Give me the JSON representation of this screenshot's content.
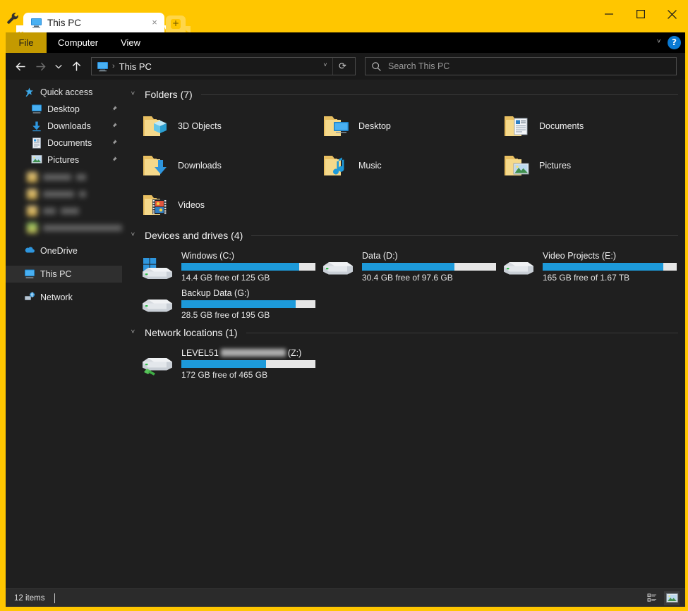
{
  "window": {
    "accent_color": "#ffc600",
    "content_bg": "#1f1f1f",
    "tool_icon": "wrench-icon",
    "tab_title": "This PC",
    "tab_close_glyph": "×",
    "newtab_glyph": "+",
    "minimize_glyph": "─",
    "maximize_glyph": "□",
    "close_glyph": "✕"
  },
  "ribbon": {
    "tabs": [
      {
        "label": "File",
        "selected": true
      },
      {
        "label": "Computer",
        "selected": false
      },
      {
        "label": "View",
        "selected": false
      }
    ],
    "collapse_glyph": "ⱽ",
    "help_glyph": "?"
  },
  "address": {
    "back_glyph": "←",
    "forward_glyph": "→",
    "recent_glyph": "ⱽ",
    "up_glyph": "↑",
    "crumb_icon": "this-pc-icon",
    "crumb_sep": "›",
    "crumb_text": "This PC",
    "dropdown_glyph": "ⱽ",
    "refresh_glyph": "⟳"
  },
  "search": {
    "icon": "search-icon",
    "placeholder": "Search This PC",
    "value": ""
  },
  "sidebar": {
    "items": [
      {
        "label": "Quick access",
        "icon": "star-pin-icon",
        "indent": 0,
        "pinned": false,
        "selected": false
      },
      {
        "label": "Desktop",
        "icon": "desktop-icon",
        "indent": 1,
        "pinned": true,
        "selected": false
      },
      {
        "label": "Downloads",
        "icon": "downloads-icon",
        "indent": 1,
        "pinned": true,
        "selected": false
      },
      {
        "label": "Documents",
        "icon": "documents-icon",
        "indent": 1,
        "pinned": true,
        "selected": false
      },
      {
        "label": "Pictures",
        "icon": "pictures-icon",
        "indent": 1,
        "pinned": true,
        "selected": false
      }
    ],
    "redacted_items": [
      {
        "icon_tint": "yellow",
        "bar1": 62,
        "bar2": 22
      },
      {
        "icon_tint": "yellow",
        "bar1": 74,
        "bar2": 40
      },
      {
        "icon_tint": "yellow",
        "bar1": 30,
        "bar2": 46
      },
      {
        "icon_tint": "green",
        "bar1": 120,
        "bar2": 0
      }
    ],
    "roots": [
      {
        "label": "OneDrive",
        "icon": "onedrive-cloud-icon",
        "selected": false
      },
      {
        "label": "This PC",
        "icon": "this-pc-icon",
        "selected": true
      },
      {
        "label": "Network",
        "icon": "network-icon",
        "selected": false
      }
    ]
  },
  "content": {
    "groups": [
      {
        "title": "Folders (7)",
        "chevron": "ⱽ"
      },
      {
        "title": "Devices and drives (4)",
        "chevron": "ⱽ"
      },
      {
        "title": "Network locations (1)",
        "chevron": "ⱽ"
      }
    ],
    "folders": [
      {
        "label": "3D Objects",
        "icon": "folder-3d-objects-icon"
      },
      {
        "label": "Desktop",
        "icon": "folder-desktop-icon"
      },
      {
        "label": "Documents",
        "icon": "folder-documents-icon"
      },
      {
        "label": "Downloads",
        "icon": "folder-downloads-icon"
      },
      {
        "label": "Music",
        "icon": "folder-music-icon"
      },
      {
        "label": "Pictures",
        "icon": "folder-pictures-icon"
      },
      {
        "label": "Videos",
        "icon": "folder-videos-icon"
      }
    ],
    "drives": [
      {
        "name": "Windows (C:)",
        "free_text": "14.4 GB free of 125 GB",
        "used_percent": 88,
        "icon": "windows-drive-icon",
        "redacted": false
      },
      {
        "name": "Data (D:)",
        "free_text": "30.4 GB free of 97.6 GB",
        "used_percent": 69,
        "icon": "hard-drive-icon",
        "redacted": false
      },
      {
        "name": "Video Projects (E:)",
        "free_text": "165 GB free of 1.67 TB",
        "used_percent": 90,
        "icon": "hard-drive-icon",
        "redacted": false
      },
      {
        "name": "Backup Data (G:)",
        "free_text": "28.5 GB free of 195 GB",
        "used_percent": 85,
        "icon": "hard-drive-icon",
        "redacted": false
      }
    ],
    "network_drives": [
      {
        "name_prefix": "LEVEL51",
        "name_suffix": "(Z:)",
        "free_text": "172 GB free of 465 GB",
        "used_percent": 63,
        "icon": "network-drive-icon",
        "redacted": true
      }
    ],
    "bar_fill_color": "#1d9ada",
    "bar_track_color": "#e6e6e6"
  },
  "statusbar": {
    "item_count": "12 items",
    "view_details_icon": "details-view-icon",
    "view_large_icons_icon": "large-icons-view-icon",
    "active_view": "large-icons-view-icon"
  }
}
